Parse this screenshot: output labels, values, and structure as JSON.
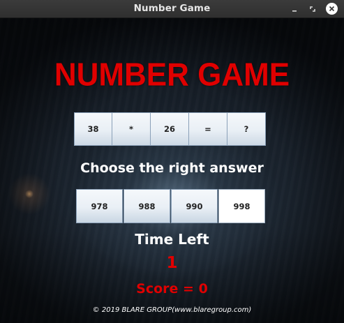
{
  "window": {
    "title": "Number Game",
    "controls": [
      "minimize-icon",
      "maximize-icon",
      "close-icon"
    ]
  },
  "game": {
    "title": "NUMBER GAME",
    "equation": [
      "38",
      "*",
      "26",
      "=",
      "?"
    ],
    "prompt": "Choose the right answer",
    "answers": [
      "978",
      "988",
      "990",
      "998"
    ],
    "time_label": "Time Left",
    "time_value": "1",
    "score_text": "Score = 0",
    "footer": "© 2019 BLARE GROUP(www.blaregroup.com)"
  },
  "colors": {
    "title_red": "#e00000",
    "score_red": "#e00000",
    "text_white": "#ffffff",
    "titlebar": "#353535"
  }
}
